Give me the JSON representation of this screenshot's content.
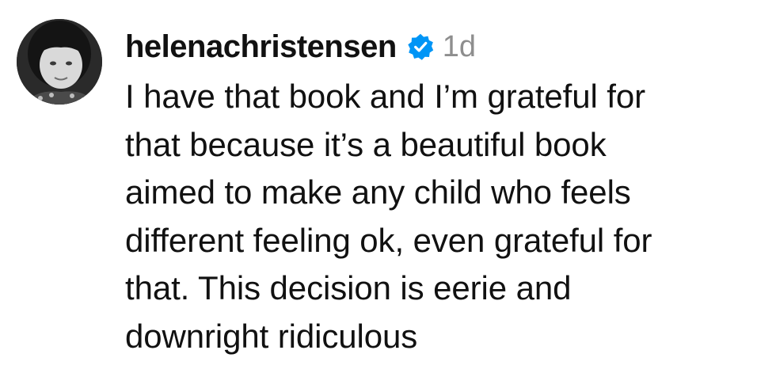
{
  "comment": {
    "username": "helenachristensen",
    "verified_icon": "verified-badge-icon",
    "timestamp": "1d",
    "text": "I have that book and I’m grateful for\nthat because it’s a beautiful book\naimed to make any child who feels\ndifferent feeling ok, even grateful for\nthat. This decision is eerie and\ndownright ridiculous",
    "avatar": "avatar-photo"
  },
  "colors": {
    "verified_blue": "#0095f6",
    "timestamp_gray": "#8e8e8e",
    "text": "#111111"
  }
}
